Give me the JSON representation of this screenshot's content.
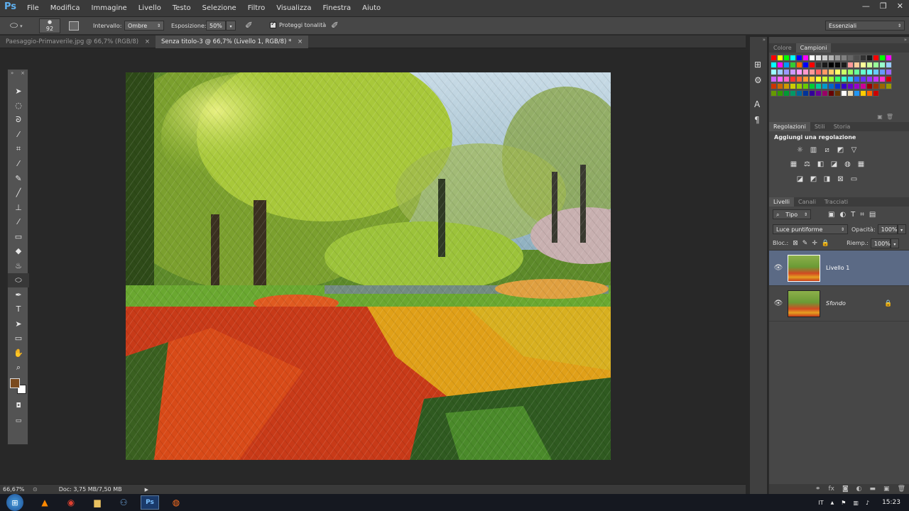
{
  "app": {
    "logo": "Ps"
  },
  "menu": [
    "File",
    "Modifica",
    "Immagine",
    "Livello",
    "Testo",
    "Selezione",
    "Filtro",
    "Visualizza",
    "Finestra",
    "Aiuto"
  ],
  "window_controls": {
    "minimize": "—",
    "restore": "❐",
    "close": "✕"
  },
  "options": {
    "brush_size": "92",
    "range_label": "Intervallo:",
    "range_value": "Ombre",
    "exposure_label": "Esposizione:",
    "exposure_value": "50%",
    "protect_label": "Proteggi tonalità",
    "protect_checked": true,
    "workspace": "Essenziali"
  },
  "tabs": [
    {
      "label": "Paesaggio-Primaverile.jpg @ 66,7% (RGB/8)",
      "active": false
    },
    {
      "label": "Senza titolo-3 @ 66,7% (Livello 1, RGB/8) *",
      "active": true
    }
  ],
  "tools": [
    "move-icon",
    "marquee-icon",
    "lasso-icon",
    "quick-select-icon",
    "crop-icon",
    "eyedropper-icon",
    "healing-icon",
    "brush-icon",
    "stamp-icon",
    "history-brush-icon",
    "eraser-icon",
    "gradient-icon",
    "blur-icon",
    "dodge-icon",
    "pen-icon",
    "type-icon",
    "path-select-icon",
    "shape-icon",
    "hand-icon",
    "zoom-icon"
  ],
  "tool_glyphs": [
    "➤",
    "◌",
    "ᘐ",
    "⁄",
    "⌗",
    "⁄",
    "✎",
    "╱",
    "⊥",
    "⁄",
    "▭",
    "◆",
    "♨",
    "⬭",
    "✒",
    "T",
    "➤",
    "▭",
    "✋",
    "⌕"
  ],
  "colors": {
    "foreground": "#7a4a1e",
    "background": "#ffffff",
    "accent": "#5fb0f0"
  },
  "status": {
    "zoom": "66,67%",
    "doc_info": "Doc: 3,75 MB/7,50 MB"
  },
  "swatch_tabs": [
    "Colore",
    "Campioni"
  ],
  "swatches": {
    "row1": [
      "#ff0000",
      "#ffff00",
      "#00ff00",
      "#00ffff",
      "#0000ff",
      "#ff00ff",
      "#ffffff",
      "#e6e6e6",
      "#cccccc",
      "#b3b3b3",
      "#999999",
      "#808080",
      "#666666",
      "#4d4d4d",
      "#333333",
      "#1a1a1a",
      "#ff0000",
      "#00ff00",
      "#ff00ff"
    ],
    "row2": [
      "#00ffff",
      "#ff00ff",
      "#0099ff",
      "#33cc33",
      "#ff6600",
      "#0000ff",
      "#ff0000",
      "#333333",
      "#1a1a1a",
      "#000000",
      "#0a0a0a",
      "#1c1c1c",
      "#ff9999",
      "#ffcc99",
      "#ffff99",
      "#ccff99",
      "#99ff99",
      "#99ffcc",
      "#99ccff"
    ],
    "row3": [
      "#99ffff",
      "#99ccff",
      "#9999ff",
      "#cc99ff",
      "#ff99ff",
      "#ff99cc",
      "#ff9999",
      "#ff6666",
      "#ff9966",
      "#ffcc66",
      "#ffff66",
      "#ccff66",
      "#99ff66",
      "#66ff99",
      "#66ffcc",
      "#66ffff",
      "#66ccff",
      "#6699ff",
      "#9966ff"
    ],
    "row4": [
      "#cc66ff",
      "#ff66ff",
      "#ff66cc",
      "#ff3333",
      "#ff6633",
      "#ff9933",
      "#ffcc33",
      "#ffff33",
      "#ccff33",
      "#99ff33",
      "#33ff66",
      "#33ffcc",
      "#33ccff",
      "#3366ff",
      "#6633ff",
      "#9933ff",
      "#cc33ff",
      "#ff33cc",
      "#cc0000"
    ],
    "row5": [
      "#cc3300",
      "#cc6600",
      "#cc9900",
      "#cccc00",
      "#99cc00",
      "#66cc00",
      "#00cc33",
      "#00cc99",
      "#0099cc",
      "#0066cc",
      "#0033cc",
      "#3300cc",
      "#6600cc",
      "#9900cc",
      "#cc0099",
      "#990000",
      "#993300",
      "#996600",
      "#999900"
    ],
    "row6": [
      "#669900",
      "#339900",
      "#009933",
      "#009966",
      "#006699",
      "#003399",
      "#330099",
      "#660099",
      "#990066",
      "#660000",
      "#663300",
      "#ffffff",
      "#e8d8b0",
      "#2196f3",
      "#ffcc00",
      "#ff6600",
      "#cc0000"
    ]
  },
  "adjustments": {
    "tabs": [
      "Regolazioni",
      "Stili",
      "Storia"
    ],
    "title": "Aggiungi una regolazione",
    "row1": [
      "brightness-icon",
      "levels-icon",
      "curves-icon",
      "exposure-icon",
      "vibrance-icon"
    ],
    "row1_glyphs": [
      "☼",
      "▥",
      "⧄",
      "◩",
      "▽"
    ],
    "row2": [
      "hue-saturation-icon",
      "color-balance-icon",
      "black-white-icon",
      "photo-filter-icon",
      "channel-mixer-icon",
      "color-lookup-icon"
    ],
    "row2_glyphs": [
      "▦",
      "⚖",
      "◧",
      "◪",
      "◍",
      "▦"
    ],
    "row3": [
      "invert-icon",
      "posterize-icon",
      "threshold-icon",
      "selective-color-icon",
      "gradient-map-icon"
    ],
    "row3_glyphs": [
      "◪",
      "◩",
      "◨",
      "⊠",
      "▭"
    ]
  },
  "layers": {
    "tabs": [
      "Livelli",
      "Canali",
      "Tracciati"
    ],
    "kind_filter": "Tipo",
    "blend_mode": "Luce puntiforme",
    "opacity_label": "Opacità:",
    "opacity_value": "100%",
    "lock_label": "Bloc.:",
    "fill_label": "Riemp.:",
    "fill_value": "100%",
    "items": [
      {
        "name": "Livello 1",
        "selected": true,
        "locked": false
      },
      {
        "name": "Sfondo",
        "selected": false,
        "locked": true
      }
    ]
  },
  "taskbar": {
    "apps": [
      "vlc-icon",
      "chrome-icon",
      "explorer-icon",
      "network-icon",
      "photoshop-icon",
      "firefox-icon"
    ],
    "lang": "IT",
    "time": "15:23"
  }
}
